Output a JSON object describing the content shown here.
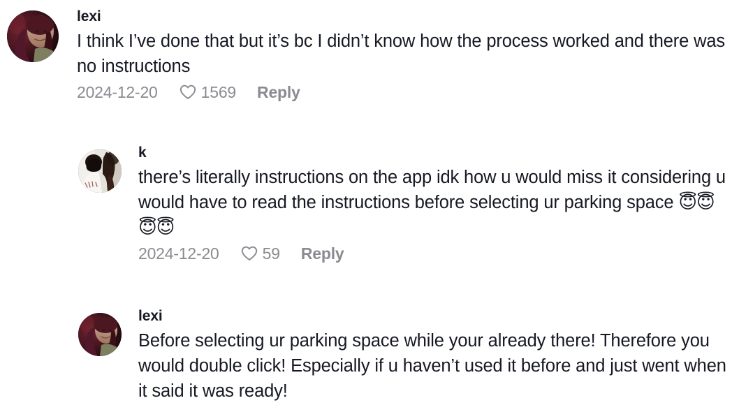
{
  "thread": {
    "background_color": "#ffffff",
    "text_color": "#161823",
    "meta_color": "#8a8b91",
    "comments": [
      {
        "id": "comment-0",
        "level": 0,
        "username": "lexi",
        "avatar_name": "avatar-lexi",
        "text": "I think I’ve done that but it’s bc I didn’t know how the process worked and there was no instructions",
        "date": "2024-12-20",
        "like_icon": "heart-icon",
        "like_count": "1569",
        "reply_label": "Reply"
      },
      {
        "id": "comment-1",
        "level": 1,
        "username": "k",
        "avatar_name": "avatar-k",
        "text": "there’s literally instructions on the app idk how u would miss it considering u would have to read the instructions before selecting ur parking space ",
        "emoji": "😇😇😇😇",
        "date": "2024-12-20",
        "like_icon": "heart-icon",
        "like_count": "59",
        "reply_label": "Reply"
      },
      {
        "id": "comment-2",
        "level": 1,
        "username": "lexi",
        "avatar_name": "avatar-lexi",
        "text": "Before selecting ur parking space while your already there! Therefore you would double click! Especially if u haven’t used it before and just went when it said it was ready!"
      }
    ]
  }
}
